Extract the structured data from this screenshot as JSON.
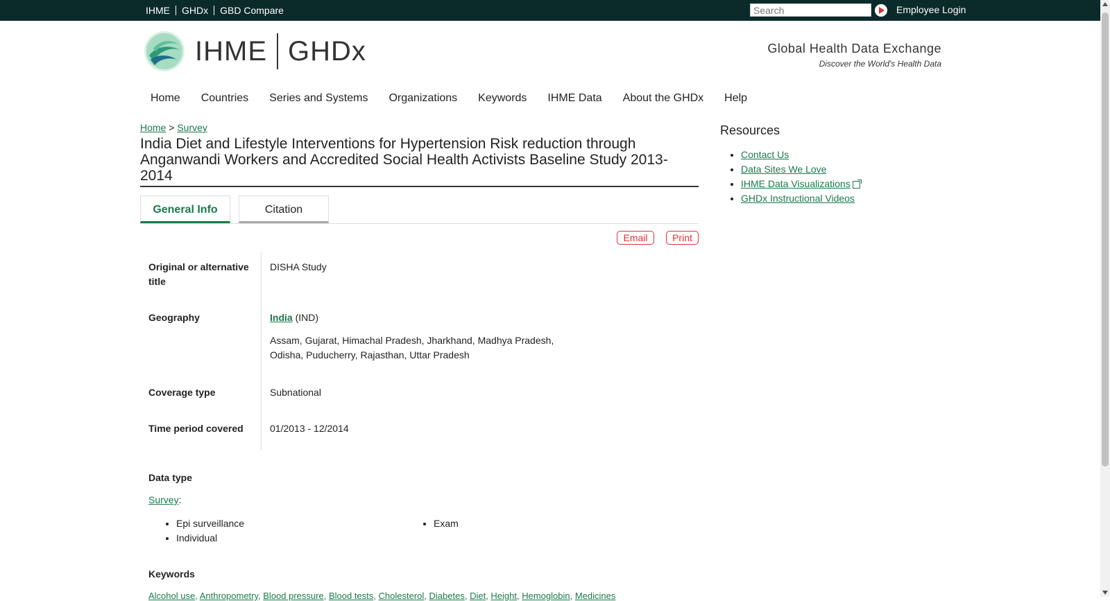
{
  "topbar": {
    "links": [
      "IHME",
      "GHDx",
      "GBD Compare"
    ],
    "search_placeholder": "Search",
    "employee_login": "Employee Login"
  },
  "header": {
    "brand_left": "IHME",
    "brand_right": "GHDx",
    "tagline_title": "Global Health Data Exchange",
    "tagline_sub": "Discover the World's Health Data"
  },
  "nav": [
    "Home",
    "Countries",
    "Series and Systems",
    "Organizations",
    "Keywords",
    "IHME Data",
    "About the GHDx",
    "Help"
  ],
  "breadcrumb": {
    "home": "Home",
    "sep": ">",
    "current": "Survey"
  },
  "page_title": "India Diet and Lifestyle Interventions for Hypertension Risk reduction through Anganwandi Workers and Accredited Social Health Activists Baseline Study 2013-2014",
  "tabs": [
    "General Info",
    "Citation"
  ],
  "actions": {
    "email": "Email",
    "print": "Print"
  },
  "fields": {
    "alt_title": {
      "label": "Original or alternative title",
      "value": "DISHA Study"
    },
    "geography": {
      "label": "Geography",
      "country_link": "India",
      "country_code": "(IND)",
      "regions": "Assam, Gujarat, Himachal Pradesh, Jharkhand, Madhya Pradesh, Odisha, Puducherry, Rajasthan, Uttar Pradesh"
    },
    "coverage": {
      "label": "Coverage type",
      "value": "Subnational"
    },
    "time_period": {
      "label": "Time period covered",
      "value": "01/2013 - 12/2014"
    }
  },
  "data_type": {
    "label": "Data type",
    "link": "Survey",
    "colon": ":",
    "col1": [
      "Epi surveillance",
      "Individual"
    ],
    "col2": [
      "Exam"
    ]
  },
  "keywords": {
    "label": "Keywords",
    "items": [
      "Alcohol use",
      "Anthropometry",
      "Blood pressure",
      "Blood tests",
      "Cholesterol",
      "Diabetes",
      "Diet",
      "Height",
      "Hemoglobin",
      "Medicines"
    ]
  },
  "resources": {
    "title": "Resources",
    "items": [
      "Contact Us",
      "Data Sites We Love",
      "IHME Data Visualizations",
      "GHDx Instructional Videos"
    ]
  },
  "colors": {
    "topbar": "#0b2a2a",
    "link_green": "#1a7a4c",
    "action_red": "#dd3333"
  }
}
